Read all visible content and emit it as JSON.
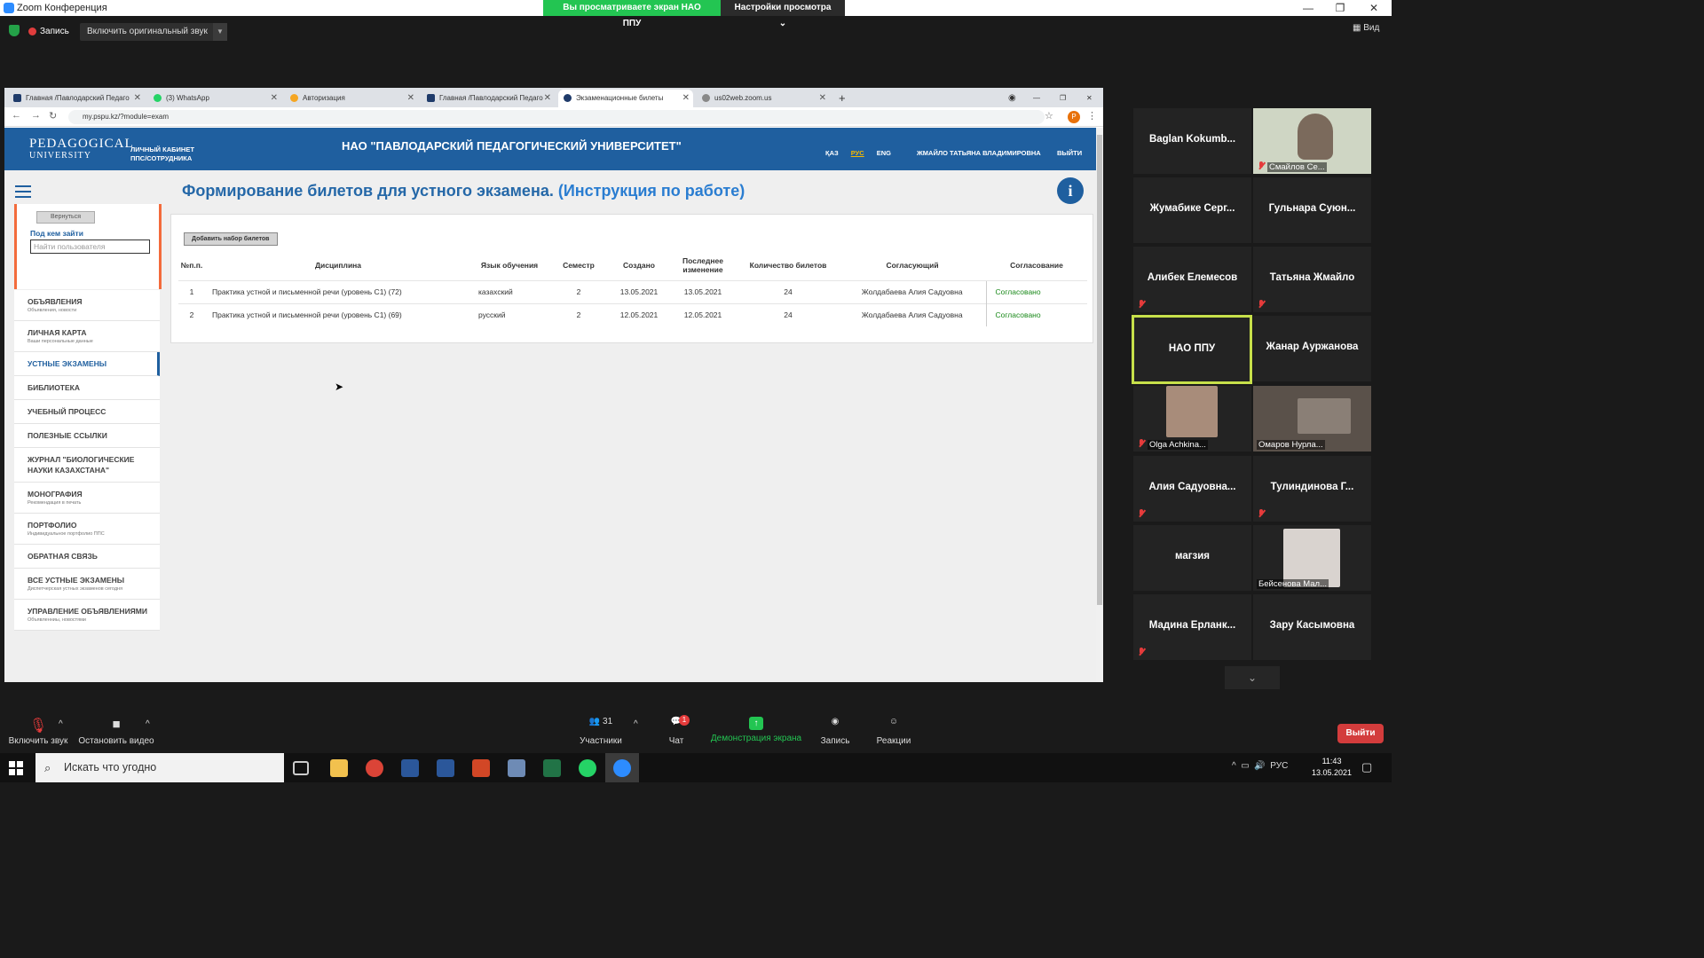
{
  "zoom": {
    "window_title": "Zoom Конференция",
    "share_banner": "Вы просматриваете экран НАО ППУ",
    "view_settings": "Настройки просмотра ⌄",
    "record": "Запись",
    "original_sound": "Включить оригинальный звук",
    "view": "Вид"
  },
  "browser": {
    "tabs": [
      {
        "label": "Главная /Павлодарский Педаго",
        "color": "#1f3b6a"
      },
      {
        "label": "(3) WhatsApp",
        "color": "#25d366"
      },
      {
        "label": "Авторизация",
        "color": "#f5a623"
      },
      {
        "label": "Главная /Павлодарский Педаго",
        "color": "#1f3b6a"
      },
      {
        "label": "Экзаменационные билеты",
        "color": "#1f3b6a"
      },
      {
        "label": "us02web.zoom.us",
        "color": "#888888"
      }
    ],
    "url": "my.pspu.kz/?module=exam",
    "profile_letter": "P"
  },
  "site": {
    "logo_main": "PEDAGOGICAL",
    "logo_sub": "UNIVERSITY",
    "cabinet_line1": "ЛИЧНЫЙ КАБИНЕТ",
    "cabinet_line2": "ППС/СОТРУДНИКА",
    "university": "НАО \"ПАВЛОДАРСКИЙ ПЕДАГОГИЧЕСКИЙ УНИВЕРСИТЕТ\"",
    "langs": [
      "ҚАЗ",
      "РУС",
      "ENG"
    ],
    "user": "ЖМАЙЛО ТАТЬЯНА ВЛАДИМИРОВНА",
    "logout": "ВЫЙТИ",
    "page_title": "Формирование билетов для устного экзамена.",
    "page_title_link": "(Инструкция по работе)",
    "info_icon": "i"
  },
  "sidebar": {
    "back": "Вернуться",
    "login_as_label": "Под кем зайти",
    "find_user_placeholder": "Найти пользователя",
    "items": [
      {
        "title": "ОБЪЯВЛЕНИЯ",
        "sub": "Объявления, новости"
      },
      {
        "title": "ЛИЧНАЯ КАРТА",
        "sub": "Ваши персональные данные"
      },
      {
        "title": "УСТНЫЕ ЭКЗАМЕНЫ",
        "sub": ""
      },
      {
        "title": "БИБЛИОТЕКА",
        "sub": ""
      },
      {
        "title": "УЧЕБНЫЙ ПРОЦЕСС",
        "sub": ""
      },
      {
        "title": "ПОЛЕЗНЫЕ ССЫЛКИ",
        "sub": ""
      },
      {
        "title": "ЖУРНАЛ \"БИОЛОГИЧЕСКИЕ НАУКИ КАЗАХСТАНА\"",
        "sub": ""
      },
      {
        "title": "МОНОГРАФИЯ",
        "sub": "Рекомендация в печать"
      },
      {
        "title": "ПОРТФОЛИО",
        "sub": "Индивидуальное портфолио ППС"
      },
      {
        "title": "ОБРАТНАЯ СВЯЗЬ",
        "sub": ""
      },
      {
        "title": "ВСЕ УСТНЫЕ ЭКЗАМЕНЫ",
        "sub": "Диспетчерская устных экзаменов сегодня"
      },
      {
        "title": "УПРАВЛЕНИЕ ОБЪЯВЛЕНИЯМИ",
        "sub": "Объявленниы, новостями"
      }
    ]
  },
  "tickets": {
    "add_button": "Добавить набор билетов",
    "columns": [
      "№п.п.",
      "Дисциплина",
      "Язык обучения",
      "Семестр",
      "Создано",
      "Последнее изменение",
      "Количество билетов",
      "Согласующий",
      "Согласование"
    ],
    "rows": [
      [
        "1",
        "Практика устной и письменной речи (уровень С1) (72)",
        "казахский",
        "2",
        "13.05.2021",
        "13.05.2021",
        "24",
        "Жолдабаева Алия Садуовна",
        "Согласовано"
      ],
      [
        "2",
        "Практика устной и письменной речи (уровень С1) (69)",
        "русский",
        "2",
        "12.05.2021",
        "12.05.2021",
        "24",
        "Жолдабаева Алия Садуовна",
        "Согласовано"
      ]
    ]
  },
  "participants": [
    {
      "name": "Baglan Kokumb...",
      "muted": false,
      "video": false
    },
    {
      "name": "Смайлов Се...",
      "muted": true,
      "video": true
    },
    {
      "name": "Жумабике Серг...",
      "muted": false,
      "video": false
    },
    {
      "name": "Гульнара Суюн...",
      "muted": false,
      "video": false
    },
    {
      "name": "Алибек Елемесов",
      "muted": true,
      "video": false
    },
    {
      "name": "Татьяна Жмайло",
      "muted": true,
      "video": false
    },
    {
      "name": "НАО ППУ",
      "muted": false,
      "video": false
    },
    {
      "name": "Жанар Ауржанова",
      "muted": false,
      "video": false
    },
    {
      "name": "Olga Achkina...",
      "muted": true,
      "video": true
    },
    {
      "name": "Омаров Нурла...",
      "muted": false,
      "video": true
    },
    {
      "name": "Алия Садуовна...",
      "muted": true,
      "video": false
    },
    {
      "name": "Тулиндинова Г...",
      "muted": true,
      "video": false
    },
    {
      "name": "магзия",
      "muted": false,
      "video": false
    },
    {
      "name": "Бейсенова Мал...",
      "muted": false,
      "video": true
    },
    {
      "name": "Мадина Ерланк...",
      "muted": true,
      "video": false
    },
    {
      "name": "Зару Касымовна",
      "muted": false,
      "video": false
    }
  ],
  "controls": {
    "unmute": "Включить звук",
    "stop_video": "Остановить видео",
    "participants": "Участники",
    "participants_count": "31",
    "chat": "Чат",
    "chat_badge": "1",
    "share": "Демонстрация экрана",
    "record": "Запись",
    "reactions": "Реакции",
    "leave": "Выйти"
  },
  "taskbar": {
    "search_placeholder": "Искать что угодно",
    "lang": "РУС",
    "time": "11:43",
    "date": "13.05.2021"
  },
  "colors": {
    "accent": "#1f5f9f",
    "zoom_green": "#23c552",
    "leave_red": "#d33c3c"
  }
}
